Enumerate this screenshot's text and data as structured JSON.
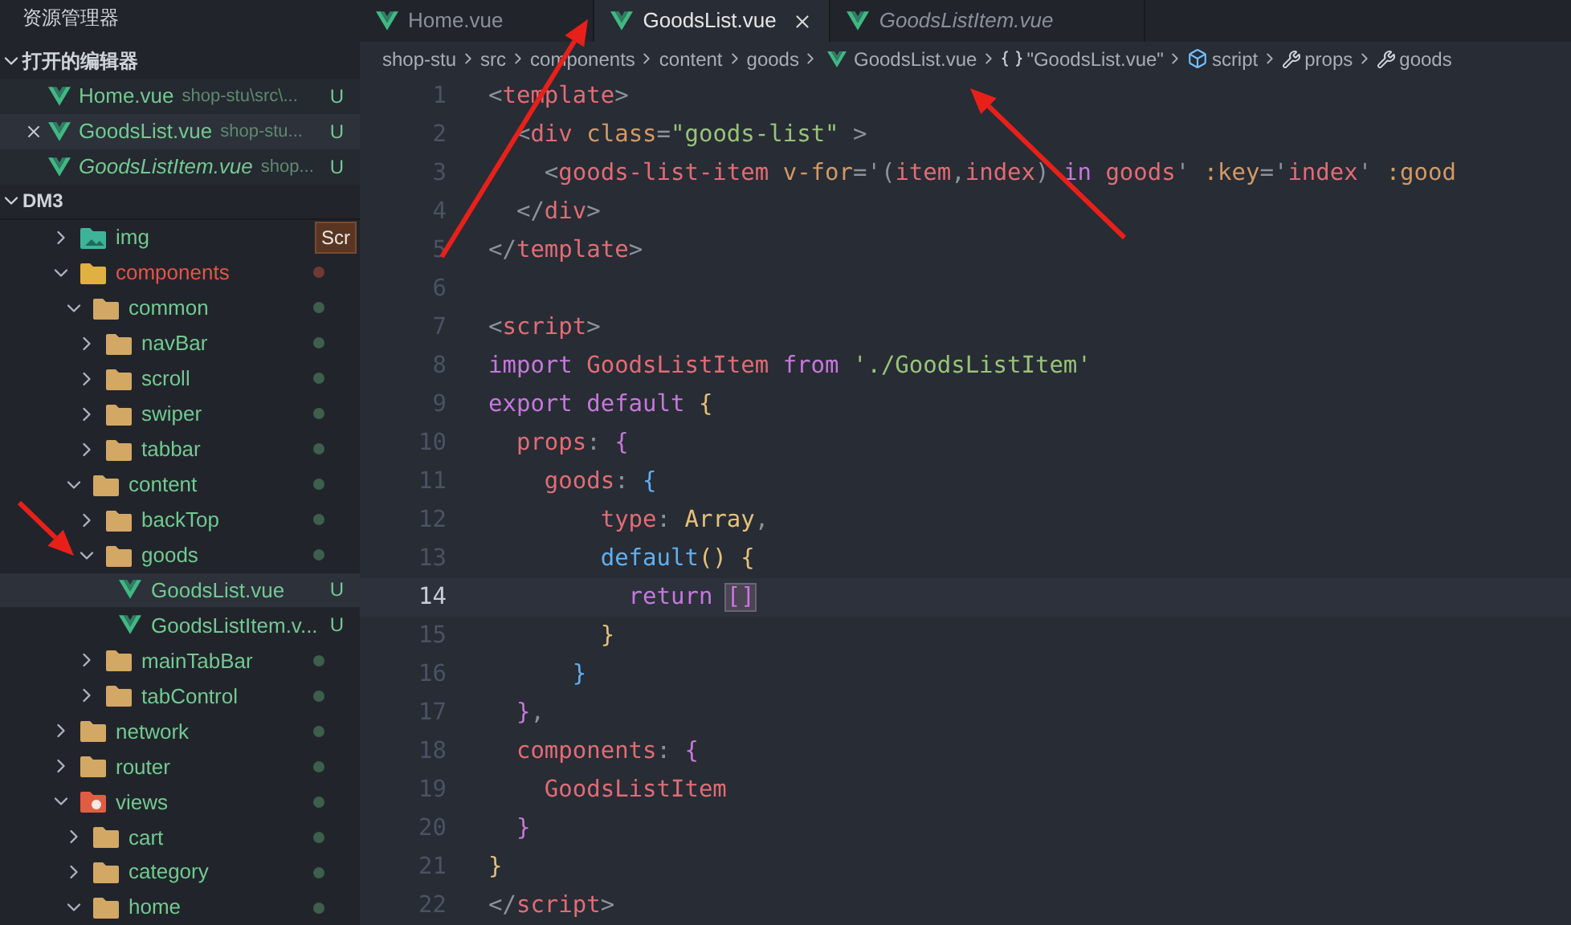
{
  "sidebar": {
    "title": "资源管理器",
    "open_editors": {
      "title": "打开的编辑器",
      "expanded": true,
      "items": [
        {
          "name": "Home.vue",
          "path": "shop-stu\\src\\...",
          "badge": "U",
          "selected": false,
          "preview": false
        },
        {
          "name": "GoodsList.vue",
          "path": "shop-stu...",
          "badge": "U",
          "selected": true,
          "preview": false
        },
        {
          "name": "GoodsListItem.vue",
          "path": "shop...",
          "badge": "U",
          "selected": false,
          "preview": true
        }
      ]
    },
    "project": {
      "title": "DM3",
      "expanded": true,
      "tree": [
        {
          "name": "img",
          "kind": "folder-image",
          "expanded": false,
          "error": false,
          "selected": false,
          "tooltip": "Scr"
        },
        {
          "name": "components",
          "kind": "folder-special",
          "expanded": true,
          "error": true,
          "selected": false,
          "color": "#6e3a33",
          "children": [
            {
              "name": "common",
              "kind": "folder",
              "expanded": true,
              "error": false,
              "selected": false,
              "color": "#3d5f4b",
              "children": [
                {
                  "name": "navBar",
                  "kind": "folder",
                  "expanded": false,
                  "error": false,
                  "selected": false,
                  "color": "#3d5f4b"
                },
                {
                  "name": "scroll",
                  "kind": "folder",
                  "expanded": false,
                  "error": false,
                  "selected": false,
                  "color": "#3d5f4b"
                },
                {
                  "name": "swiper",
                  "kind": "folder",
                  "expanded": false,
                  "error": false,
                  "selected": false,
                  "color": "#3d5f4b"
                },
                {
                  "name": "tabbar",
                  "kind": "folder",
                  "expanded": false,
                  "error": false,
                  "selected": false,
                  "color": "#3d5f4b"
                }
              ]
            },
            {
              "name": "content",
              "kind": "folder",
              "expanded": true,
              "error": false,
              "selected": false,
              "color": "#3d5f4b",
              "children": [
                {
                  "name": "backTop",
                  "kind": "folder",
                  "expanded": false,
                  "error": false,
                  "selected": false,
                  "color": "#3d5f4b"
                },
                {
                  "name": "goods",
                  "kind": "folder",
                  "expanded": true,
                  "error": false,
                  "selected": false,
                  "color": "#3d5f4b",
                  "children": [
                    {
                      "name": "GoodsList.vue",
                      "kind": "vue",
                      "error": false,
                      "badge": "U",
                      "selected": true
                    },
                    {
                      "name": "GoodsListItem.v...",
                      "kind": "vue",
                      "error": false,
                      "badge": "U",
                      "selected": false
                    }
                  ]
                },
                {
                  "name": "mainTabBar",
                  "kind": "folder",
                  "expanded": false,
                  "error": false,
                  "selected": false,
                  "color": "#3d5f4b"
                },
                {
                  "name": "tabControl",
                  "kind": "folder",
                  "expanded": false,
                  "error": false,
                  "selected": false,
                  "color": "#3d5f4b"
                }
              ]
            }
          ]
        },
        {
          "name": "network",
          "kind": "folder",
          "expanded": false,
          "error": false,
          "selected": false,
          "color": "#3d5f4b"
        },
        {
          "name": "router",
          "kind": "folder",
          "expanded": false,
          "error": false,
          "selected": false,
          "color": "#3d5f4b"
        },
        {
          "name": "views",
          "kind": "folder-views",
          "expanded": true,
          "error": false,
          "selected": false,
          "color": "#3d5f4b",
          "children": [
            {
              "name": "cart",
              "kind": "folder",
              "expanded": false,
              "error": false,
              "selected": false,
              "color": "#3d5f4b"
            },
            {
              "name": "category",
              "kind": "folder",
              "expanded": false,
              "error": false,
              "selected": false,
              "color": "#3d5f4b"
            },
            {
              "name": "home",
              "kind": "folder",
              "expanded": true,
              "error": false,
              "selected": false,
              "color": "#3d5f4b"
            }
          ]
        }
      ]
    }
  },
  "tabs": [
    {
      "label": "Home.vue",
      "selected": false,
      "preview": false
    },
    {
      "label": "GoodsList.vue",
      "selected": true,
      "preview": false
    },
    {
      "label": "GoodsListItem.vue",
      "selected": false,
      "preview": true
    }
  ],
  "breadcrumbs": [
    {
      "label": "shop-stu",
      "kind": "text"
    },
    {
      "label": "src",
      "kind": "text"
    },
    {
      "label": "components",
      "kind": "text"
    },
    {
      "label": "content",
      "kind": "text"
    },
    {
      "label": "goods",
      "kind": "text"
    },
    {
      "label": "GoodsList.vue",
      "kind": "vue"
    },
    {
      "label": "\"GoodsList.vue\"",
      "kind": "object"
    },
    {
      "label": "script",
      "kind": "module"
    },
    {
      "label": "props",
      "kind": "property"
    },
    {
      "label": "goods",
      "kind": "property"
    }
  ],
  "code": [
    {
      "number": "1",
      "current": false,
      "tokens": [
        {
          "kind": "punct",
          "text": "<"
        },
        {
          "kind": "tag",
          "text": "template"
        },
        {
          "kind": "punct",
          "text": ">"
        }
      ]
    },
    {
      "number": "2",
      "current": false,
      "tokens": [
        {
          "kind": "punct",
          "text": "  <"
        },
        {
          "kind": "tag",
          "text": "div "
        },
        {
          "kind": "attr",
          "text": "class"
        },
        {
          "kind": "punct",
          "text": "="
        },
        {
          "kind": "string",
          "text": "\"goods-list\""
        },
        {
          "kind": "punct",
          "text": " >"
        }
      ]
    },
    {
      "number": "3",
      "current": false,
      "tokens": [
        {
          "kind": "punct",
          "text": "    <"
        },
        {
          "kind": "tag",
          "text": "goods-list-item "
        },
        {
          "kind": "attr",
          "text": "v-for"
        },
        {
          "kind": "punct",
          "text": "='("
        },
        {
          "kind": "ident",
          "text": "item"
        },
        {
          "kind": "punct",
          "text": ","
        },
        {
          "kind": "ident",
          "text": "index"
        },
        {
          "kind": "punct",
          "text": ") "
        },
        {
          "kind": "keyword",
          "text": "in "
        },
        {
          "kind": "ident",
          "text": "goods"
        },
        {
          "kind": "punct",
          "text": "' "
        },
        {
          "kind": "attr",
          "text": ":key"
        },
        {
          "kind": "punct",
          "text": "='"
        },
        {
          "kind": "ident",
          "text": "index"
        },
        {
          "kind": "punct",
          "text": "' "
        },
        {
          "kind": "attr",
          "text": ":good"
        }
      ]
    },
    {
      "number": "4",
      "current": false,
      "tokens": [
        {
          "kind": "punct",
          "text": "  </"
        },
        {
          "kind": "tag",
          "text": "div"
        },
        {
          "kind": "punct",
          "text": ">"
        }
      ]
    },
    {
      "number": "5",
      "current": false,
      "tokens": [
        {
          "kind": "punct",
          "text": "</"
        },
        {
          "kind": "tag",
          "text": "template"
        },
        {
          "kind": "punct",
          "text": ">"
        }
      ]
    },
    {
      "number": "6",
      "current": false
    },
    {
      "number": "7",
      "current": false,
      "tokens": [
        {
          "kind": "punct",
          "text": "<"
        },
        {
          "kind": "tag",
          "text": "script"
        },
        {
          "kind": "punct",
          "text": ">"
        }
      ]
    },
    {
      "number": "8",
      "current": false,
      "tokens": [
        {
          "kind": "keyword",
          "text": "import "
        },
        {
          "kind": "ident",
          "text": "GoodsListItem "
        },
        {
          "kind": "keyword",
          "text": "from "
        },
        {
          "kind": "string",
          "text": "'./GoodsListItem'"
        }
      ]
    },
    {
      "number": "9",
      "current": false,
      "tokens": [
        {
          "kind": "keyword",
          "text": "export default "
        },
        {
          "kind": "brace-yellow",
          "text": "{"
        }
      ]
    },
    {
      "number": "10",
      "current": false,
      "tokens": [
        {
          "kind": "ident",
          "text": "  props"
        },
        {
          "kind": "punct",
          "text": ": "
        },
        {
          "kind": "brace-purple",
          "text": "{"
        }
      ]
    },
    {
      "number": "11",
      "current": false,
      "tokens": [
        {
          "kind": "ident",
          "text": "    goods"
        },
        {
          "kind": "punct",
          "text": ": "
        },
        {
          "kind": "brace-blue",
          "text": "{"
        }
      ]
    },
    {
      "number": "12",
      "current": false,
      "tokens": [
        {
          "kind": "ident",
          "text": "        type"
        },
        {
          "kind": "punct",
          "text": ": "
        },
        {
          "kind": "type",
          "text": "Array"
        },
        {
          "kind": "punct",
          "text": ","
        }
      ]
    },
    {
      "number": "13",
      "current": false,
      "tokens": [
        {
          "kind": "function",
          "text": "        default"
        },
        {
          "kind": "brace-yellow",
          "text": "() {"
        }
      ]
    },
    {
      "number": "14",
      "current": true,
      "tokens": [
        {
          "kind": "keyword",
          "text": "          return "
        },
        {
          "kind": "match",
          "text": "[]"
        }
      ]
    },
    {
      "number": "15",
      "current": false,
      "tokens": [
        {
          "kind": "brace-yellow",
          "text": "        }"
        }
      ]
    },
    {
      "number": "16",
      "current": false,
      "tokens": [
        {
          "kind": "brace-blue",
          "text": "      }"
        }
      ]
    },
    {
      "number": "17",
      "current": false,
      "tokens": [
        {
          "kind": "brace-purple",
          "text": "  }"
        },
        {
          "kind": "punct",
          "text": ","
        }
      ]
    },
    {
      "number": "18",
      "current": false,
      "tokens": [
        {
          "kind": "ident",
          "text": "  components"
        },
        {
          "kind": "punct",
          "text": ": "
        },
        {
          "kind": "brace-purple",
          "text": "{"
        }
      ]
    },
    {
      "number": "19",
      "current": false,
      "tokens": [
        {
          "kind": "ident",
          "text": "    GoodsListItem"
        }
      ]
    },
    {
      "number": "20",
      "current": false,
      "tokens": [
        {
          "kind": "brace-purple",
          "text": "  }"
        }
      ]
    },
    {
      "number": "21",
      "current": false,
      "tokens": [
        {
          "kind": "brace-yellow",
          "text": "}"
        }
      ]
    },
    {
      "number": "22",
      "current": false,
      "tokens": [
        {
          "kind": "punct",
          "text": "</"
        },
        {
          "kind": "tag",
          "text": "script"
        },
        {
          "kind": "punct",
          "text": ">"
        }
      ]
    }
  ]
}
